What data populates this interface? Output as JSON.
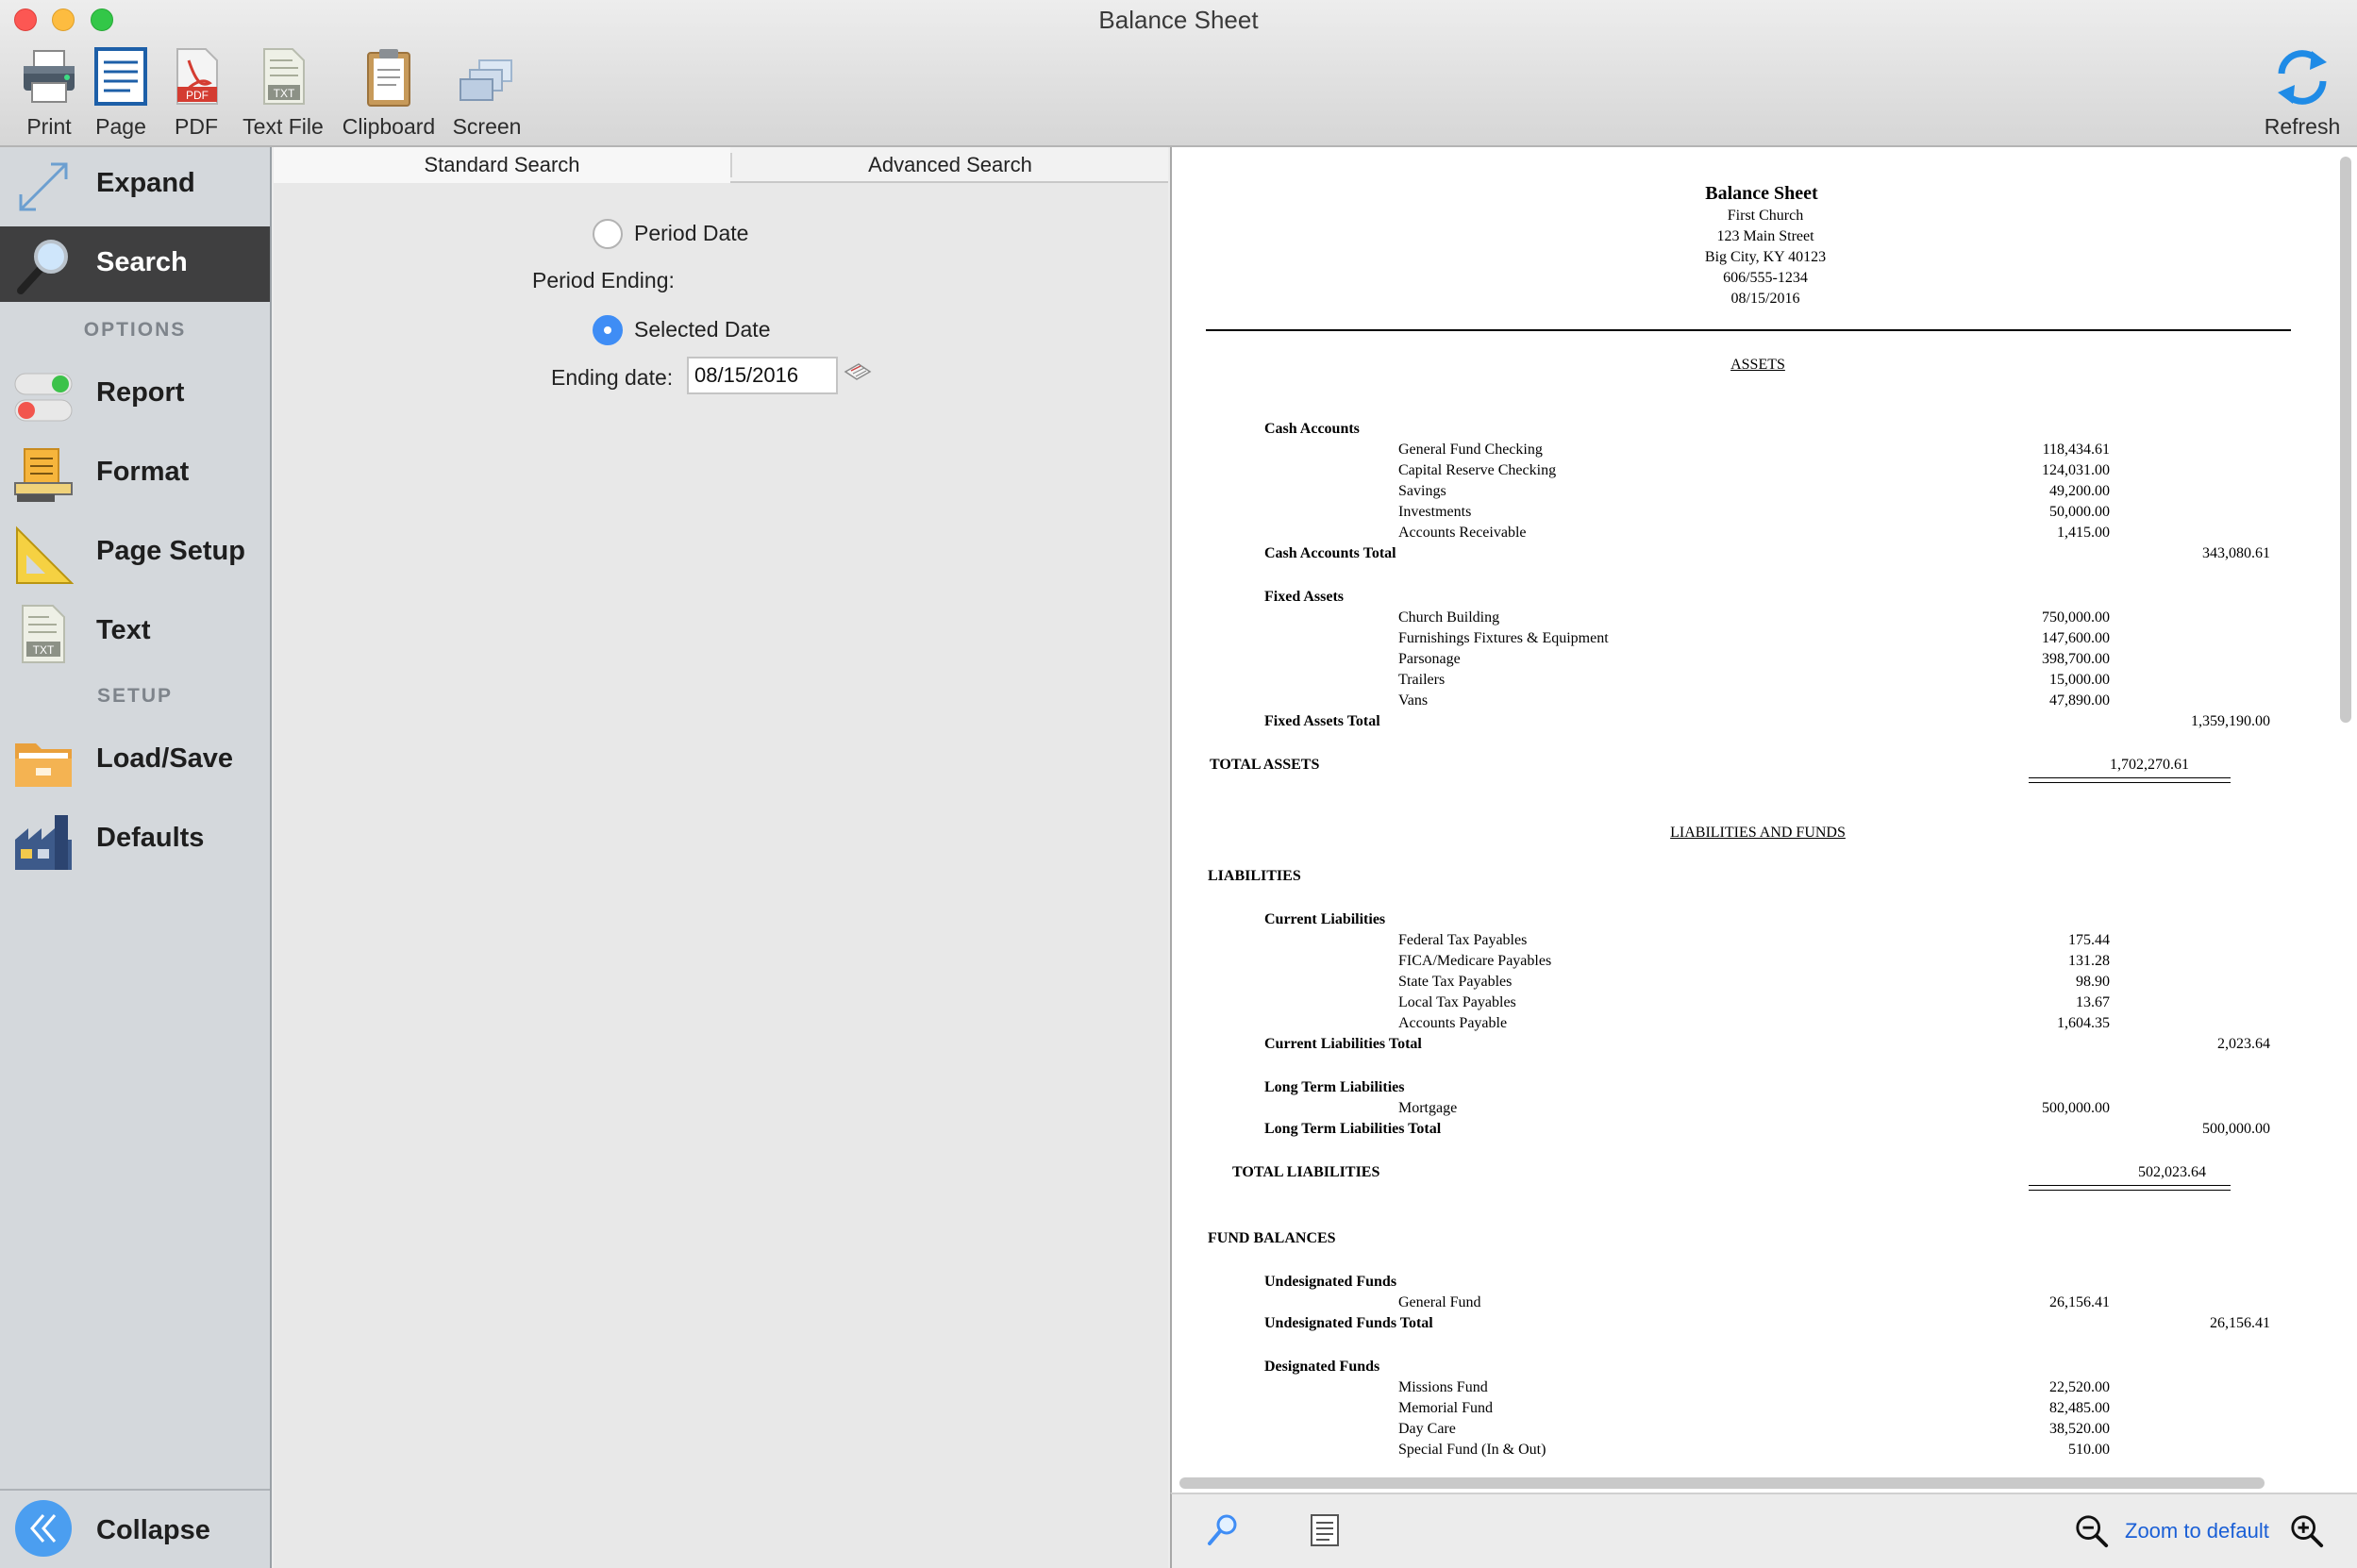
{
  "window": {
    "title": "Balance Sheet"
  },
  "toolbar": {
    "print": "Print",
    "page": "Page",
    "pdf": "PDF",
    "text_file": "Text File",
    "clipboard": "Clipboard",
    "screen": "Screen",
    "refresh": "Refresh",
    "pdf_badge": "PDF",
    "txt_badge": "TXT"
  },
  "sidebar": {
    "expand": "Expand",
    "search": "Search",
    "options_header": "OPTIONS",
    "report": "Report",
    "format": "Format",
    "page_setup": "Page Setup",
    "text": "Text",
    "setup_header": "SETUP",
    "load_save": "Load/Save",
    "defaults": "Defaults",
    "collapse": "Collapse",
    "txt_badge": "TXT"
  },
  "search": {
    "tabs": [
      "Standard Search",
      "Advanced Search"
    ],
    "period_date": "Period Date",
    "period_ending": "Period Ending:",
    "selected_date": "Selected Date",
    "ending_date_label": "Ending date:",
    "ending_date_value": "08/15/2016",
    "selected_option": "Selected Date"
  },
  "report": {
    "title": "Balance Sheet",
    "org": "First Church",
    "address": "123 Main Street",
    "city": "Big City, KY  40123",
    "phone": "606/555-1234",
    "date": "08/15/2016",
    "assets_header": "ASSETS",
    "cash_accounts": "Cash Accounts",
    "cash_items": [
      {
        "name": "General Fund Checking",
        "amount": "118,434.61"
      },
      {
        "name": "Capital Reserve Checking",
        "amount": "124,031.00"
      },
      {
        "name": "Savings",
        "amount": "49,200.00"
      },
      {
        "name": "Investments",
        "amount": "50,000.00"
      },
      {
        "name": "Accounts Receivable",
        "amount": "1,415.00"
      }
    ],
    "cash_total_label": "Cash Accounts Total",
    "cash_total": "343,080.61",
    "fixed_assets": "Fixed Assets",
    "fixed_items": [
      {
        "name": "Church Building",
        "amount": "750,000.00"
      },
      {
        "name": "Furnishings Fixtures & Equipment",
        "amount": "147,600.00"
      },
      {
        "name": "Parsonage",
        "amount": "398,700.00"
      },
      {
        "name": "Trailers",
        "amount": "15,000.00"
      },
      {
        "name": "Vans",
        "amount": "47,890.00"
      }
    ],
    "fixed_total_label": "Fixed Assets Total",
    "fixed_total": "1,359,190.00",
    "total_assets_label": "TOTAL ASSETS",
    "total_assets": "1,702,270.61",
    "liab_funds_header": "LIABILITIES AND FUNDS",
    "liabilities": "LIABILITIES",
    "current_liab": "Current Liabilities",
    "current_items": [
      {
        "name": "Federal Tax Payables",
        "amount": "175.44"
      },
      {
        "name": "FICA/Medicare Payables",
        "amount": "131.28"
      },
      {
        "name": "State Tax Payables",
        "amount": "98.90"
      },
      {
        "name": "Local Tax Payables",
        "amount": "13.67"
      },
      {
        "name": "Accounts Payable",
        "amount": "1,604.35"
      }
    ],
    "current_total_label": "Current Liabilities Total",
    "current_total": "2,023.64",
    "long_term": "Long Term Liabilities",
    "long_items": [
      {
        "name": "Mortgage",
        "amount": "500,000.00"
      }
    ],
    "long_total_label": "Long Term Liabilities Total",
    "long_total": "500,000.00",
    "total_liab_label": "TOTAL LIABILITIES",
    "total_liab": "502,023.64",
    "fund_balances": "FUND BALANCES",
    "undesignated": "Undesignated Funds",
    "undesignated_items": [
      {
        "name": "General Fund",
        "amount": "26,156.41"
      }
    ],
    "undesignated_total_label": "Undesignated Funds Total",
    "undesignated_total": "26,156.41",
    "designated": "Designated Funds",
    "designated_items": [
      {
        "name": "Missions Fund",
        "amount": "22,520.00"
      },
      {
        "name": "Memorial Fund",
        "amount": "82,485.00"
      },
      {
        "name": "Day Care",
        "amount": "38,520.00"
      },
      {
        "name": "Special Fund (In & Out)",
        "amount": "510.00"
      }
    ]
  },
  "bottom": {
    "zoom_default": "Zoom to default"
  },
  "colors": {
    "accent": "#3f8df5",
    "sidebar_bg": "#d4d8dc",
    "sidebar_active": "#3f3f40",
    "link": "#1a5fd6"
  }
}
